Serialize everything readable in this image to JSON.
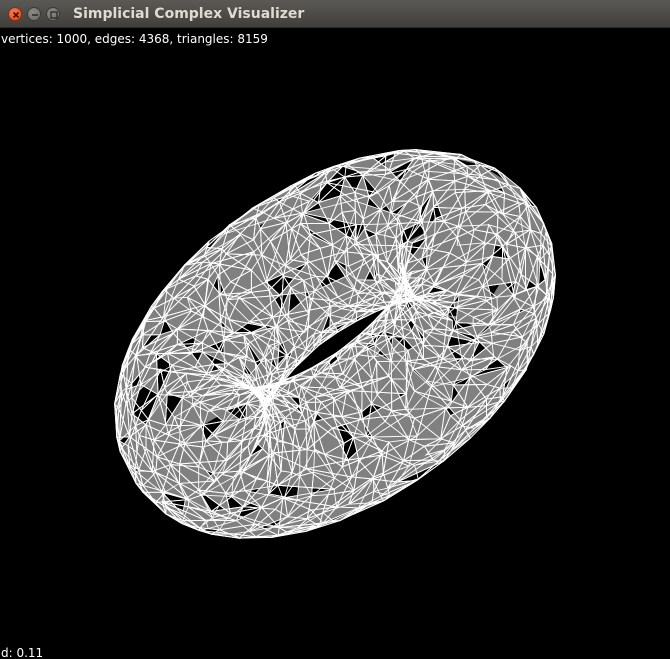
{
  "window": {
    "title": "Simplicial Complex Visualizer"
  },
  "overlay": {
    "stats_text": "vertices: 1000, edges: 4368, triangles: 8159",
    "d_text": "d: 0.11"
  },
  "render": {
    "background": "#000000",
    "edge_color": "#ffffff",
    "triangle_fill": "#808080",
    "shape": "torus wireframe"
  }
}
